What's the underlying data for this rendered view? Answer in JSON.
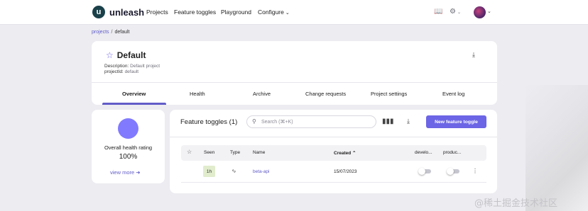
{
  "colors": {
    "accent": "#6c65e5",
    "link": "#615cc8",
    "health_circle": "#817afe",
    "seen_badge": "#e0eccc"
  },
  "header": {
    "logo_glyph": "u",
    "logo_text": "unleash",
    "nav": [
      "Projects",
      "Feature toggles",
      "Playground",
      "Configure"
    ],
    "icons": [
      "book-icon",
      "gear-icon",
      "avatar"
    ]
  },
  "breadcrumb": {
    "parent": "projects",
    "separator": "/",
    "current": "default"
  },
  "project": {
    "name": "Default",
    "description_label": "Description:",
    "description": "Default project",
    "id_label": "projectId:",
    "id": "default",
    "tabs": [
      "Overview",
      "Health",
      "Archive",
      "Change requests",
      "Project settings",
      "Event log"
    ],
    "active_tab": "Overview"
  },
  "health": {
    "label": "Overall health rating",
    "value": "100%",
    "view_more": "view more"
  },
  "toggles": {
    "title": "Feature toggles (1)",
    "search_placeholder": "Search (⌘+K)",
    "new_button": "New feature toggle",
    "columns": [
      "Seen",
      "Type",
      "Name",
      "Created",
      "develo...",
      "produc..."
    ],
    "sorted_by": "Created",
    "rows": [
      {
        "seen": "1h",
        "type_icon": "experiment-icon",
        "name": "beta-api",
        "created": "15/07/2023",
        "development_enabled": false,
        "production_enabled": false
      }
    ]
  },
  "watermark": "@稀土掘金技术社区"
}
